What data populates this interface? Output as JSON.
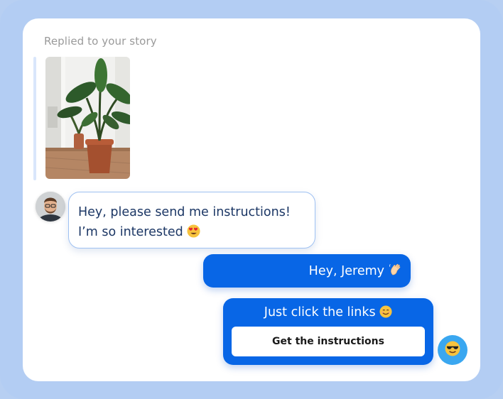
{
  "story": {
    "replied_label": "Replied to your story",
    "image_icon": "potted-plant-photo"
  },
  "messages": {
    "incoming": {
      "line1": "Hey, please send me instructions!",
      "line2": "I’m so interested",
      "emoji": "heart-eyes-emoji"
    },
    "outgoing_greeting": {
      "text": "Hey, Jeremy",
      "emoji": "waving-hand-emoji"
    },
    "outgoing_links": {
      "text": "Just click the links",
      "emoji": "smiling-face-emoji",
      "button_label": "Get the instructions"
    }
  },
  "avatars": {
    "user": "user-avatar-photo",
    "bot": "sunglasses-emoji"
  },
  "colors": {
    "background": "#b3cdf3",
    "bubble_out": "#0866e6",
    "bubble_in_border": "#9fc1f2",
    "bubble_in_text": "#1c3765",
    "bot_avatar": "#3aa7f0"
  }
}
